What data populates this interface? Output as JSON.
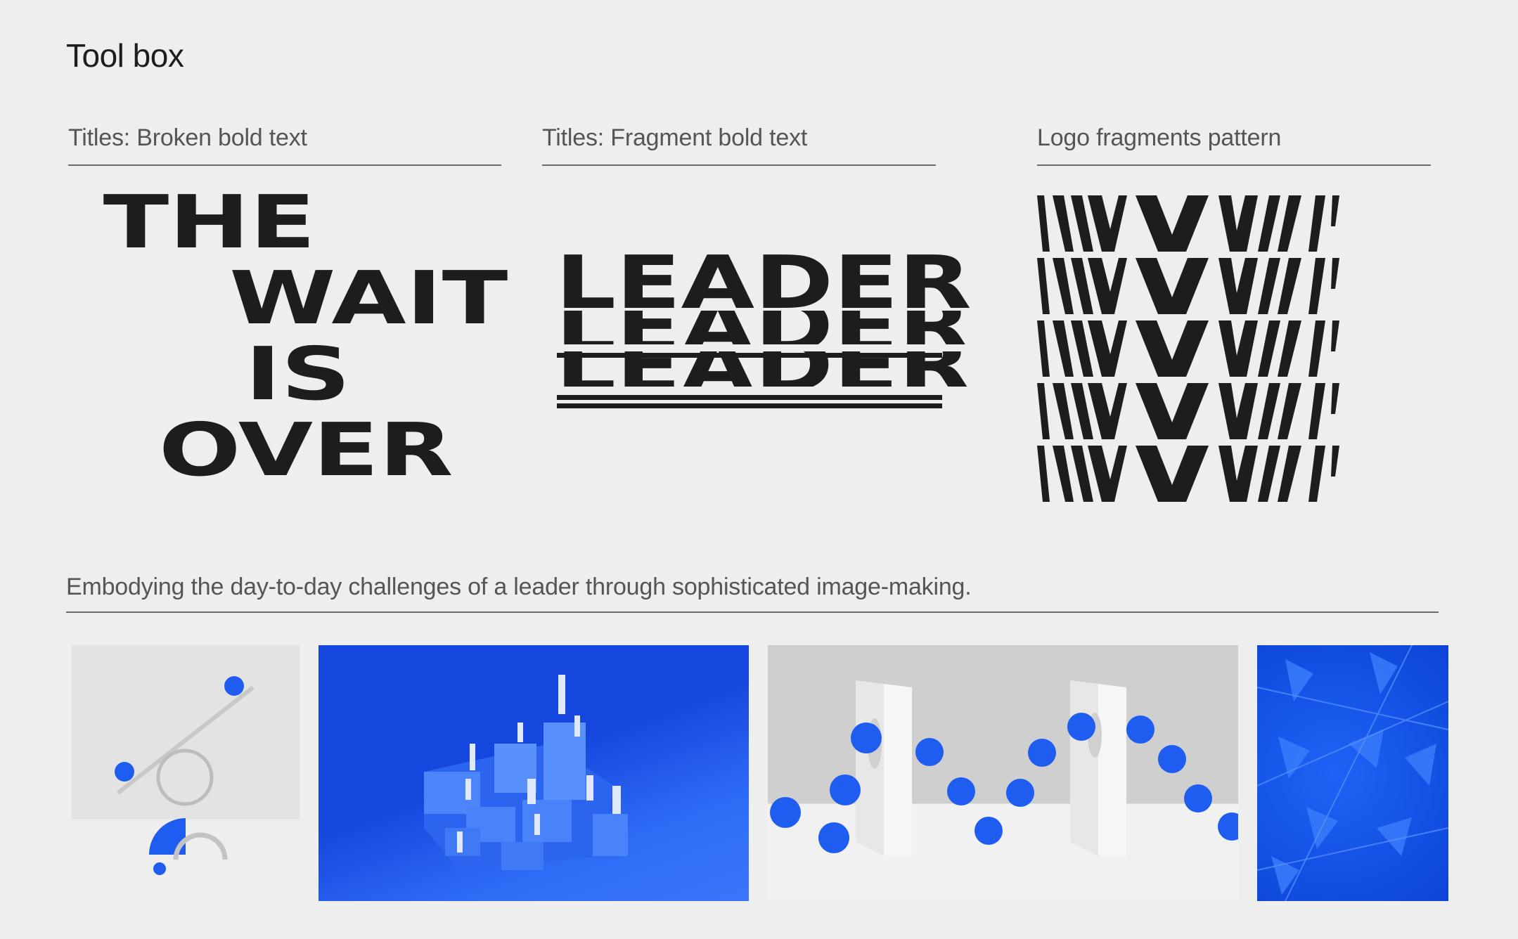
{
  "page": {
    "title": "Tool box"
  },
  "sections": {
    "broken": {
      "label": "Titles: Broken bold text",
      "lines": [
        "THE",
        "WAIT",
        "IS",
        "OVER"
      ]
    },
    "fragment": {
      "label": "Titles: Fragment bold text",
      "word": "LEADER"
    },
    "logo": {
      "label": "Logo fragments pattern"
    }
  },
  "tagline": "Embodying the day-to-day challenges of a leader through sophisticated image-making.",
  "colors": {
    "background": "#eeeeee",
    "ink": "#1d1d1f",
    "brand_blue": "#1f5cf0"
  }
}
